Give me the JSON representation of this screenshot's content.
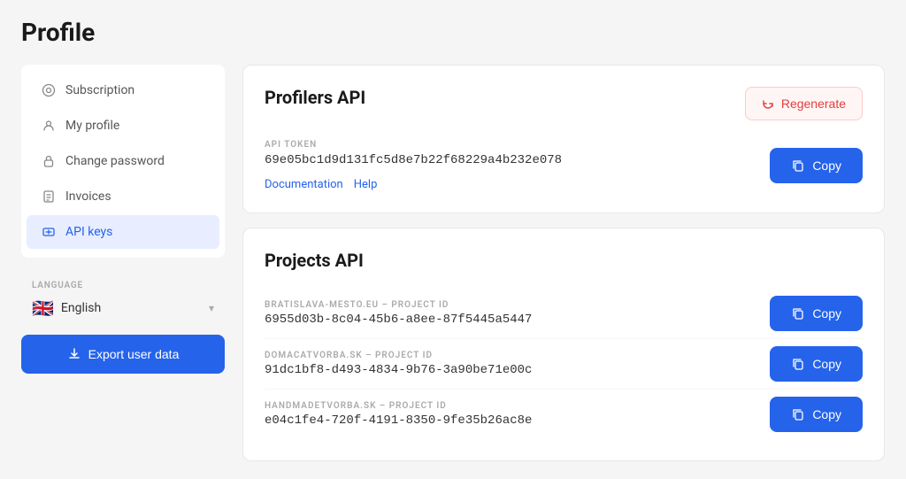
{
  "page": {
    "title": "Profile"
  },
  "sidebar": {
    "items": [
      {
        "id": "subscription",
        "label": "Subscription",
        "icon": "○",
        "active": false
      },
      {
        "id": "my-profile",
        "label": "My profile",
        "icon": "👤",
        "active": false
      },
      {
        "id": "change-password",
        "label": "Change password",
        "icon": "🔒",
        "active": false
      },
      {
        "id": "invoices",
        "label": "Invoices",
        "icon": "📋",
        "active": false
      },
      {
        "id": "api-keys",
        "label": "API keys",
        "icon": "🔑",
        "active": true
      }
    ],
    "language": {
      "label": "LANGUAGE",
      "flag": "🇬🇧",
      "name": "English",
      "chevron": "▾"
    },
    "export_button": "Export user data"
  },
  "main": {
    "profilers_api": {
      "title": "Profilers API",
      "regenerate_label": "Regenerate",
      "token_label": "API TOKEN",
      "token_value": "69e05bc1d9d131fc5d8e7b22f68229a4b232e078",
      "copy_label": "Copy",
      "links": [
        {
          "label": "Documentation"
        },
        {
          "label": "Help"
        }
      ]
    },
    "projects_api": {
      "title": "Projects API",
      "projects": [
        {
          "label": "BRATISLAVA-MESTO.EU – PROJECT ID",
          "value": "6955d03b-8c04-45b6-a8ee-87f5445a5447",
          "copy_label": "Copy"
        },
        {
          "label": "DOMACATVORBA.SK – PROJECT ID",
          "value": "91dc1bf8-d493-4834-9b76-3a90be71e00c",
          "copy_label": "Copy"
        },
        {
          "label": "HANDMADETVORBA.SK – PROJECT ID",
          "value": "e04c1fe4-720f-4191-8350-9fe35b26ac8e",
          "copy_label": "Copy"
        }
      ]
    }
  }
}
